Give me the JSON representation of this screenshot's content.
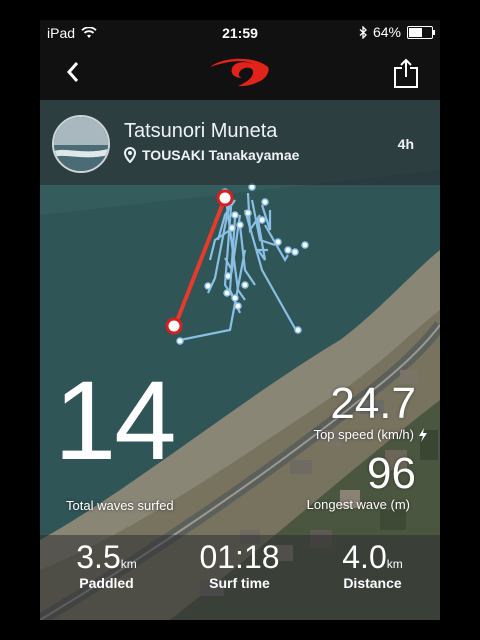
{
  "status_bar": {
    "device": "iPad",
    "time": "21:59",
    "battery": "64%",
    "battery_level": 0.64
  },
  "nav": {
    "back_icon": "chevron-left-icon",
    "logo_icon": "brand-wave-logo",
    "share_icon": "share-icon",
    "accent_color": "#e2231a"
  },
  "session": {
    "surfer_name": "Tatsunori Muneta",
    "location": "TOUSAKI Tanakayamae",
    "time_ago": "4h"
  },
  "stats": {
    "total_waves": "14",
    "total_waves_label": "Total waves surfed",
    "top_speed": "24.7",
    "top_speed_label": "Top speed (km/h)",
    "longest_wave": "96",
    "longest_wave_label": "Longest wave (m)"
  },
  "summary": {
    "paddled_value": "3.5",
    "paddled_unit": "km",
    "paddled_label": "Paddled",
    "surf_time_value": "01:18",
    "surf_time_label": "Surf time",
    "distance_value": "4.0",
    "distance_unit": "km",
    "distance_label": "Distance"
  }
}
